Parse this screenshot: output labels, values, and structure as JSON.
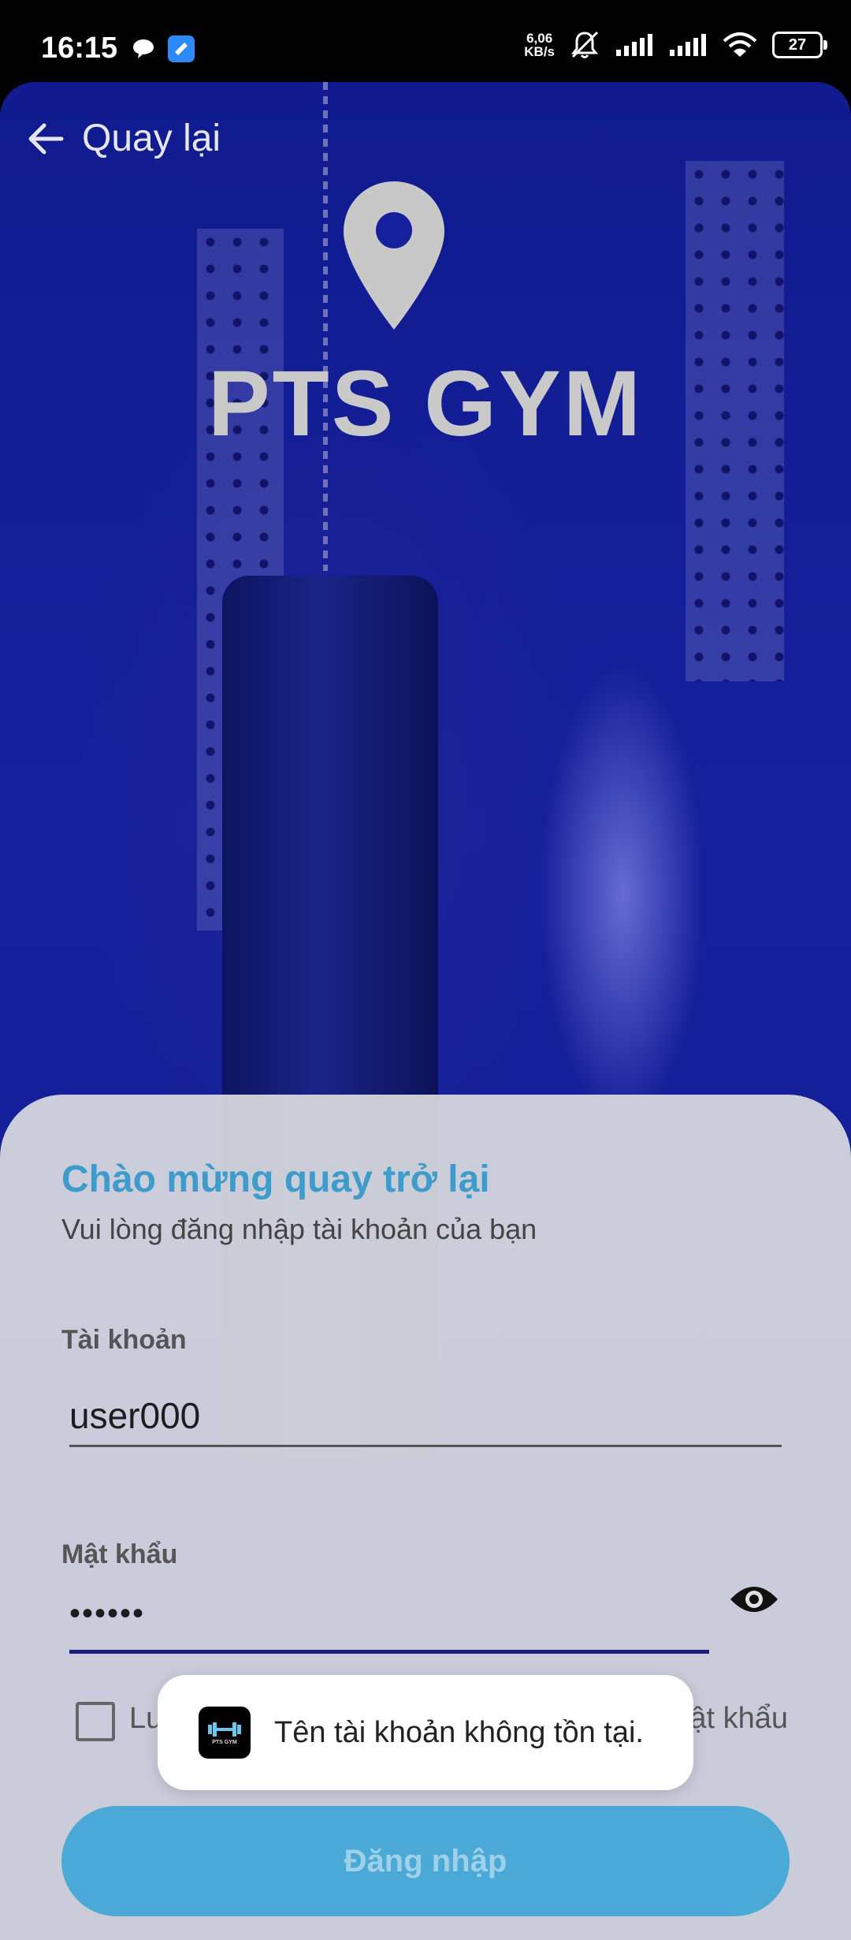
{
  "status_bar": {
    "time": "16:15",
    "net_speed_value": "6,06",
    "net_speed_unit": "KB/s",
    "battery": "27",
    "icons": [
      "message-icon",
      "app-icon",
      "mute-icon",
      "signal-icon",
      "signal-icon",
      "wifi-icon",
      "battery-icon"
    ]
  },
  "header": {
    "back_label": "Quay lại",
    "brand": "PTS GYM"
  },
  "login": {
    "welcome": "Chào mừng quay trở lại",
    "subtitle": "Vui lòng đăng nhập tài khoản của bạn",
    "account_label": "Tài khoản",
    "account_value": "user000",
    "password_label": "Mật khẩu",
    "password_value": "••••••",
    "remember_label": "Lu",
    "forgot_label": "ật khẩu",
    "login_button": "Đăng nhập"
  },
  "toast": {
    "message": "Tên tài khoản không tồn tại.",
    "icon_text": "PTS GYM"
  },
  "colors": {
    "background": "#15209c",
    "accent": "#3d9ccc",
    "button": "#4aa9d6",
    "sheet": "#dfe0e2"
  }
}
